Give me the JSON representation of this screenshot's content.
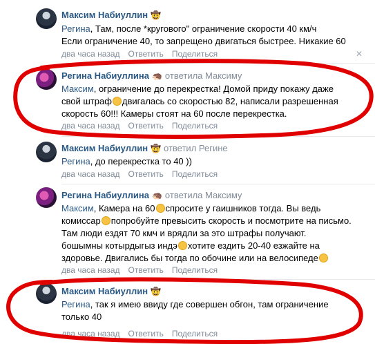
{
  "comments": [
    {
      "author": "Максим Набиуллин",
      "emoji": "🤠",
      "replied_to": "",
      "lines": [
        {
          "addr": "Регина",
          "text": ", Там, после *кругового\" ограничение скорости 40 км/ч"
        },
        {
          "addr": "",
          "text": "Если ограничение 40, то запрещено двигаться быстрее. Никакие 60"
        }
      ],
      "time": "два часа назад",
      "reply": "Ответить",
      "share": "Поделиться",
      "close": "✕"
    },
    {
      "author": "Регина Набиуллина",
      "emoji": "🦔",
      "replied_to": "ответила Максиму",
      "line1_addr": "Максим",
      "line1_text": ", ограничение до перекрестка! Домой приду покажу даже",
      "line2a": "свой штраф",
      "line2b": "двигалась со скоростью 82, написали разрешенная",
      "line3": "скорость 60!!! Камеры стоят на 60 после перекрестка.",
      "time": "два часа назад",
      "reply": "Ответить",
      "share": "Поделиться"
    },
    {
      "author": "Максим Набиуллин",
      "emoji": "🤠",
      "replied_to": "ответил Регине",
      "line1_addr": "Регина",
      "line1_text": ", до перекрестка то 40 ))",
      "time": "два часа назад",
      "reply": "Ответить",
      "share": "Поделиться"
    },
    {
      "author": "Регина Набиуллина",
      "emoji": "🦔",
      "replied_to": "ответила Максиму",
      "line1_addr": "Максим",
      "line1a": ", Камера на 60",
      "line1b": "спросите у гаишников тогда. Вы ведь",
      "line2a": "комиссар",
      "line2b": "попробуйте превысить скорость и посмотрите на письмо.",
      "line3": "Там люди ездят 70 кмч и врядли за это штрафы получают.",
      "line4a": "бошымны котырдыгыз индэ",
      "line4b": "хотите ездить 20-40 езжайте на",
      "line5a": "здоровье. Двигались бы тогда по обочине или на велосипеде",
      "time": "два часа назад",
      "reply": "Ответить",
      "share": "Поделиться"
    },
    {
      "author": "Максим Набиуллин",
      "emoji": "🤠",
      "replied_to": "",
      "line1_addr": "Регина",
      "line1_text": ", так я имею ввиду где совершен обгон, там ограничение",
      "line2": "только 40",
      "time": "два часа назад",
      "reply": "Ответить",
      "share": "Поделиться"
    }
  ],
  "colors": {
    "link": "#2a5885",
    "meta": "#818c99",
    "annotation": "#e00000"
  }
}
